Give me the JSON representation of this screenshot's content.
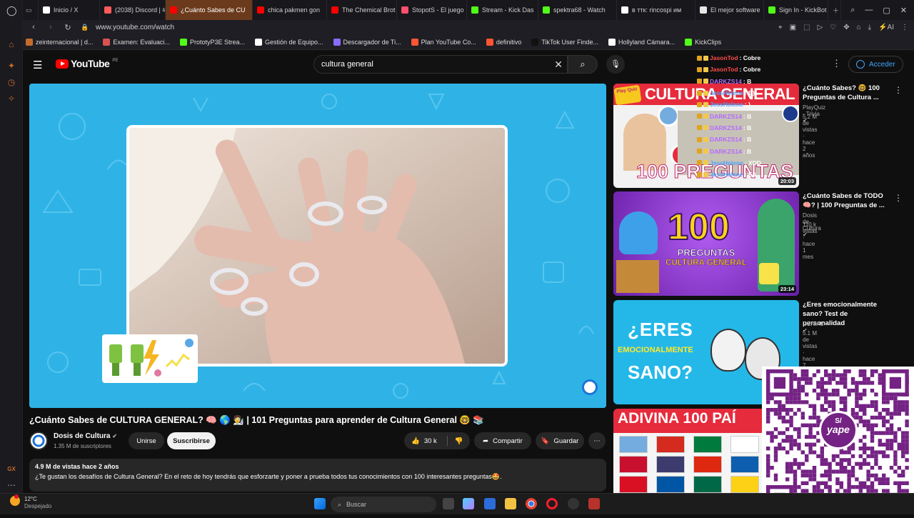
{
  "browser": {
    "tabs": [
      {
        "label": "Inicio / X",
        "color": "#ffffff"
      },
      {
        "label": "(2038) Discord | #",
        "color": "#ff5b5b"
      },
      {
        "label": "¿Cuánto Sabes de CU",
        "color": "#ff0000",
        "active": true
      },
      {
        "label": "chica pakmen gon",
        "color": "#ff0000"
      },
      {
        "label": "The Chemical Brot",
        "color": "#ff0000"
      },
      {
        "label": "StopotS - El juego",
        "color": "#ff4f6d"
      },
      {
        "label": "Stream - Kick Das",
        "color": "#53fc18"
      },
      {
        "label": "spektra68 - Watch",
        "color": "#53fc18"
      },
      {
        "label": "в ттк: rincospi им",
        "color": "#ffffff"
      },
      {
        "label": "El mejor software",
        "color": "#e6e6e6"
      },
      {
        "label": "Sign In - KickBot",
        "color": "#53fc18"
      }
    ],
    "url": "www.youtube.com/watch",
    "bookmarks": [
      {
        "label": "zeinternacional | d...",
        "color": "#c56b2b"
      },
      {
        "label": "Examen: Evaluaci...",
        "color": "#d9534f"
      },
      {
        "label": "PrototyP3E Strea...",
        "color": "#53fc18"
      },
      {
        "label": "Gestión de Equipo...",
        "color": "#ffffff"
      },
      {
        "label": "Descargador de Ti...",
        "color": "#8a6cff"
      },
      {
        "label": "Plan YouTube Co...",
        "color": "#ff5533"
      },
      {
        "label": "definitivo",
        "color": "#ff5533"
      },
      {
        "label": "TikTok User Finde...",
        "color": "#111111"
      },
      {
        "label": "Hollyland Cámara...",
        "color": "#ffffff"
      },
      {
        "label": "KickClips",
        "color": "#53fc18"
      }
    ]
  },
  "youtube": {
    "logo_text": "YouTube",
    "country": "PE",
    "search_value": "cultura general",
    "signin_label": "Acceder"
  },
  "video": {
    "title": "¿Cuánto Sabes de CULTURA GENERAL? 🧠 🌎 🧑‍🔬 | 101 Preguntas para aprender de Cultura General 🤓 📚",
    "channel": "Dosis de Cultura",
    "subscribers": "1.35 M de suscriptores",
    "join_label": "Unirse",
    "subscribe_label": "Suscribirse",
    "likes": "30 k",
    "share_label": "Compartir",
    "save_label": "Guardar",
    "views_date": "4.9 M de vistas  hace 2 años",
    "description": "¿Te gustan los desafíos de Cultura General? En el reto de hoy tendrás que esforzarte y poner a prueba todos tus conocimientos con 100 interesantes preguntas🤩."
  },
  "recommendations": [
    {
      "title": "¿Cuánto Sabes? 🤓 100 Preguntas de Cultura ...",
      "channel": "PlayQuiz · Trivia",
      "stats": "5.2 M de vistas · hace 2 años",
      "duration": "20:03",
      "thumb_text": "CULTURA GENERAL",
      "thumb_text2": "100 PREGUNTAS",
      "thumb_badge": "Play Quiz"
    },
    {
      "title": "¿Cuánto Sabes de TODO 🧠? | 100 Preguntas de ...",
      "channel": "Dosis de Cultura",
      "stats": "110 k vistas · hace 1 mes",
      "duration": "23:14",
      "thumb_text": "100",
      "thumb_text2": "PREGUNTAS",
      "thumb_text3": "CULTURA GENERAL"
    },
    {
      "title": "¿Eres emocionalmente sano? Test de personalidad",
      "channel": "GENIAL",
      "stats": "5.1 M de vistas · hace 7 años",
      "thumb_text": "¿ERES",
      "thumb_text2": "EMOCIONALMENTE",
      "thumb_text3": "SANO?"
    },
    {
      "title": "",
      "thumb_text": "ADIVINA 100 PAÍ"
    }
  ],
  "chat": [
    {
      "user": "JasonTod",
      "msg": ": Cobre",
      "color": "#ff4b4b"
    },
    {
      "user": "JasonTod",
      "msg": ": Cobre",
      "color": "#ff4b4b"
    },
    {
      "user": "DARKZS14",
      "msg": ": B",
      "color": "#b46bff"
    },
    {
      "user": "JessHelene",
      "msg": ": B)",
      "color": "#4da3ff"
    },
    {
      "user": "JessHelene",
      "msg": ": )",
      "color": "#4da3ff"
    },
    {
      "user": "DARKZS14",
      "msg": ": B",
      "color": "#b46bff"
    },
    {
      "user": "DARKZS14",
      "msg": ": B",
      "color": "#b46bff"
    },
    {
      "user": "DARKZS14",
      "msg": ": B",
      "color": "#b46bff"
    },
    {
      "user": "DARKZS14",
      "msg": ": B",
      "color": "#b46bff"
    },
    {
      "user": "JessHelene",
      "msg": ": XDD",
      "color": "#4da3ff"
    },
    {
      "user": "JessHelene",
      "msg": ": Eti",
      "color": "#4da3ff"
    }
  ],
  "overlay": {
    "qr_brand": "yape",
    "qr_symbol": "S/"
  },
  "taskbar": {
    "temperature": "12°C",
    "weather": "Despejado",
    "search_placeholder": "Buscar"
  },
  "sidebar": {
    "gx_label": "GX"
  }
}
